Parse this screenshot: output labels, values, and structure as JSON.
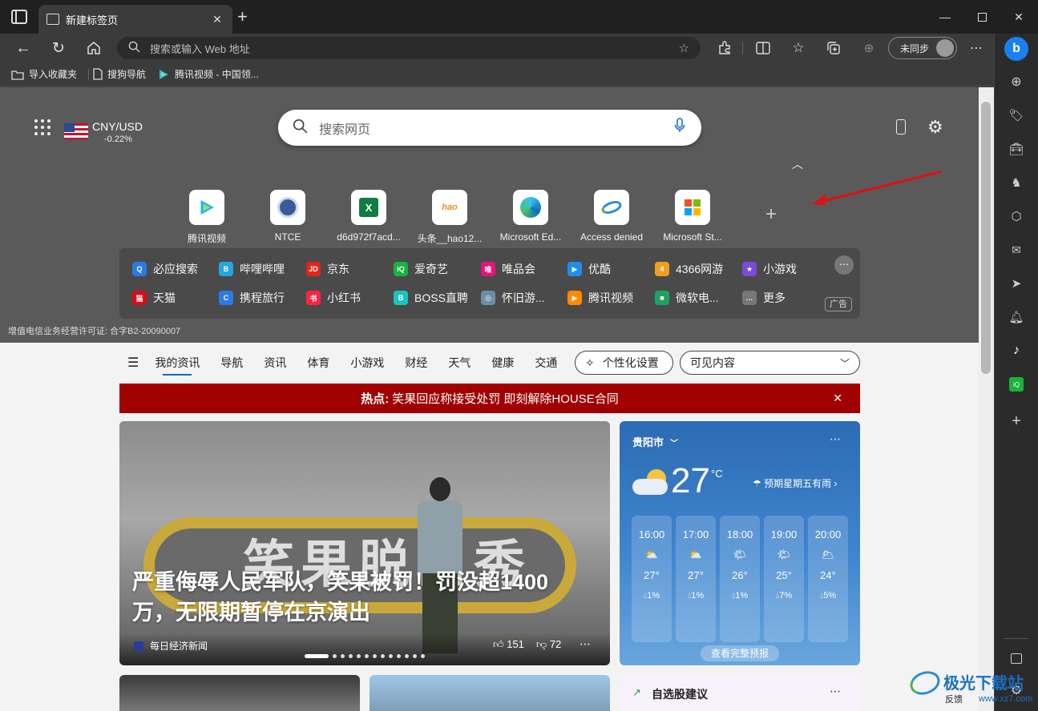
{
  "browser": {
    "tab_title": "新建标签页",
    "address_placeholder": "搜索或输入 Web 地址",
    "profile_label": "未同步"
  },
  "favorites": [
    {
      "label": "导入收藏夹",
      "icon": "import-icon"
    },
    {
      "label": "搜狗导航",
      "icon": "page-icon"
    },
    {
      "label": "腾讯视频 - 中国领...",
      "icon": "tencent-video-icon"
    }
  ],
  "hero": {
    "currency_pair": "CNY/USD",
    "currency_change": "-0.22%",
    "search_placeholder": "搜索网页",
    "license_text": "增值电信业务经营许可证: 合字B2-20090007"
  },
  "tiles": [
    {
      "label": "腾讯视频",
      "icon": "tencent-video-icon"
    },
    {
      "label": "NTCE",
      "icon": "ntce-icon"
    },
    {
      "label": "d6d972f7acd...",
      "icon": "excel-icon"
    },
    {
      "label": "头条__hao12...",
      "icon": "hao123-icon"
    },
    {
      "label": "Microsoft Ed...",
      "icon": "edge-icon"
    },
    {
      "label": "Access denied",
      "icon": "access-icon"
    },
    {
      "label": "Microsoft St...",
      "icon": "store-icon"
    }
  ],
  "quicklinks": {
    "row1": [
      {
        "label": "必应搜索",
        "color": "#2a7be4",
        "glyph": "Q"
      },
      {
        "label": "哔哩哔哩",
        "color": "#23a6e0",
        "glyph": "B"
      },
      {
        "label": "京东",
        "color": "#e1251b",
        "glyph": "JD"
      },
      {
        "label": "爱奇艺",
        "color": "#16b43b",
        "glyph": "iQ"
      },
      {
        "label": "唯品会",
        "color": "#e5137b",
        "glyph": "唯"
      },
      {
        "label": "优酷",
        "color": "#1f8eee",
        "glyph": "▶"
      },
      {
        "label": "4366网游",
        "color": "#f0a020",
        "glyph": "4"
      },
      {
        "label": "小游戏",
        "color": "#7a4cd8",
        "glyph": "★"
      }
    ],
    "row2": [
      {
        "label": "天猫",
        "color": "#d80c18",
        "glyph": "猫"
      },
      {
        "label": "携程旅行",
        "color": "#2b7be8",
        "glyph": "C"
      },
      {
        "label": "小红书",
        "color": "#ff2442",
        "glyph": "书"
      },
      {
        "label": "BOSS直聘",
        "color": "#1ac5bd",
        "glyph": "B"
      },
      {
        "label": "怀旧游...",
        "color": "#6d8fa6",
        "glyph": "◎"
      },
      {
        "label": "腾讯视频",
        "color": "#ff8a00",
        "glyph": "▶"
      },
      {
        "label": "微软电...",
        "color": "#1da462",
        "glyph": "■"
      },
      {
        "label": "更多",
        "color": "#777777",
        "glyph": "…"
      }
    ],
    "ad_label": "广告"
  },
  "feed": {
    "nav": [
      "我的资讯",
      "导航",
      "资讯",
      "体育",
      "小游戏",
      "财经",
      "天气",
      "健康",
      "交通"
    ],
    "personalize_label": "个性化设置",
    "visible_content_label": "可见内容",
    "hot_prefix": "热点:",
    "hot_text": "笑果回应称接受处罚 即刻解除HOUSE合同"
  },
  "main_news": {
    "image_text": "笑果脱口秀",
    "headline": "严重侮辱人民军队，笑果被罚！罚没超1400万，无限期暂停在京演出",
    "source": "每日经济新闻",
    "likes": "151",
    "dislikes": "72"
  },
  "weather": {
    "city": "贵阳市",
    "temperature": "27",
    "unit": "°C",
    "forecast_note": "预期星期五有雨",
    "hours": [
      {
        "time": "16:00",
        "temp": "27°",
        "rain": "1%"
      },
      {
        "time": "17:00",
        "temp": "27°",
        "rain": "1%"
      },
      {
        "time": "18:00",
        "temp": "26°",
        "rain": "1%"
      },
      {
        "time": "19:00",
        "temp": "25°",
        "rain": "7%"
      },
      {
        "time": "20:00",
        "temp": "24°",
        "rain": "5%"
      }
    ],
    "full_forecast_label": "查看完整预报"
  },
  "stocks_card": {
    "title": "自选股建议"
  },
  "watermark": {
    "text": "极光下载站",
    "url": "www.xz7.com"
  },
  "feedback_label": "反馈"
}
